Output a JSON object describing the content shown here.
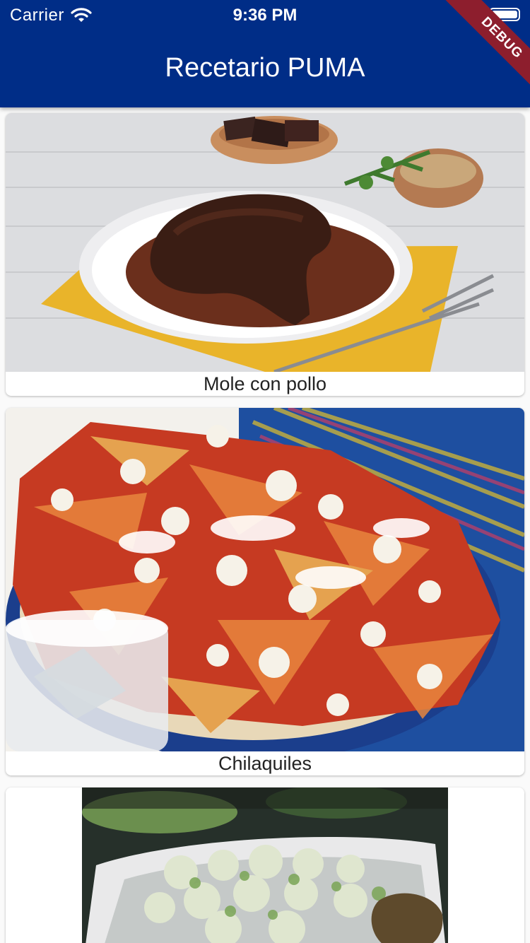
{
  "status_bar": {
    "carrier": "Carrier",
    "time": "9:36 PM"
  },
  "app_bar": {
    "title": "Recetario PUMA",
    "banner": "DEBUG",
    "color": "#002d87"
  },
  "recipes": [
    {
      "name": "Mole con pollo",
      "image": "mole-photo"
    },
    {
      "name": "Chilaquiles",
      "image": "chilaquiles-photo"
    },
    {
      "name": "",
      "image": "enchiladas-photo"
    }
  ]
}
